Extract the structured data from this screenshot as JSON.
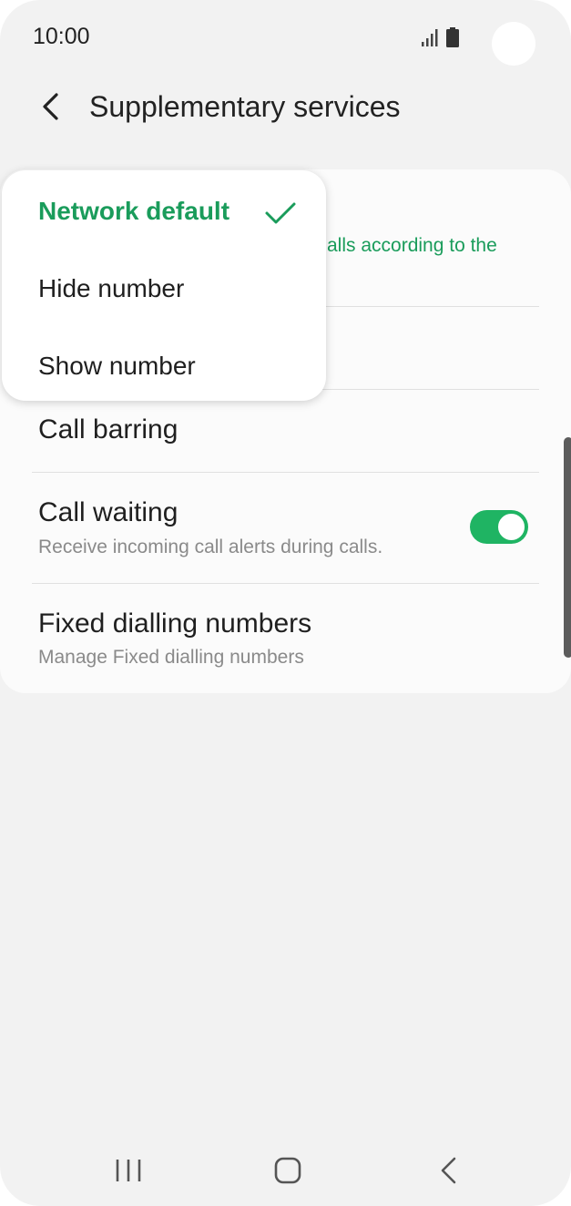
{
  "status_bar": {
    "time": "10:00",
    "signal_icon": "signal-icon",
    "battery_icon": "battery-icon"
  },
  "header": {
    "title": "Supplementary services",
    "back_icon": "chevron-left-icon"
  },
  "settings": {
    "caller_id_subtitle_fragment": "alls according to the",
    "call_barring": {
      "label": "Call barring"
    },
    "call_waiting": {
      "label": "Call waiting",
      "subtitle": "Receive incoming call alerts during calls.",
      "enabled": true
    },
    "fixed_dialling": {
      "label": "Fixed dialling numbers",
      "subtitle": "Manage Fixed dialling numbers"
    }
  },
  "popup_menu": {
    "items": [
      {
        "label": "Network default",
        "selected": true
      },
      {
        "label": "Hide number",
        "selected": false
      },
      {
        "label": "Show number",
        "selected": false
      }
    ]
  },
  "nav_bar": {
    "recents_icon": "recents-icon",
    "home_icon": "home-icon",
    "back_icon": "back-icon"
  },
  "colors": {
    "accent": "#1a9c5b",
    "toggle_on": "#1fb463",
    "background": "#f2f2f2",
    "card": "#fbfbfb"
  }
}
